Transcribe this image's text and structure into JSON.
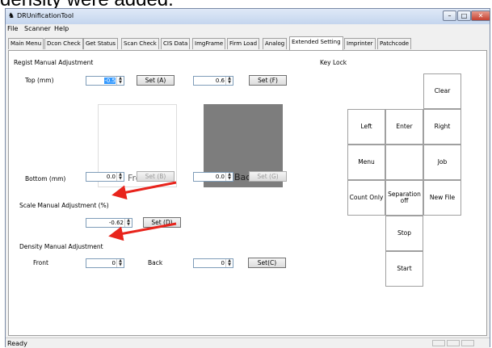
{
  "caption": "density were added.",
  "window": {
    "title": "DRUnificationTool",
    "controls": [
      "–",
      "□",
      "✕"
    ]
  },
  "menu": [
    "File",
    "Scanner",
    "Help"
  ],
  "tabs": [
    "Main Menu",
    "Dcon Check",
    "Get Status",
    "Scan Check",
    "CIS Data",
    "ImgFrame",
    "Firm Load",
    "Analog",
    "Extended Setting",
    "Imprinter",
    "Patchcode"
  ],
  "active_tab": "Extended Setting",
  "regist": {
    "title": "Regist Manual Adjustment",
    "top_label": "Top (mm)",
    "top_front": "-0.5",
    "top_back": "0.6",
    "set_a": "Set (A)",
    "set_f": "Set (F)",
    "front_label": "Front",
    "back_label": "Back",
    "bottom_label": "Bottom (mm)",
    "bottom_front": "0.0",
    "bottom_back": "0.0",
    "set_b": "Set (B)",
    "set_g": "Set (G)"
  },
  "scale": {
    "title": "Scale Manual Adjustment (%)",
    "value": "-0.62",
    "set_d": "Set (D)"
  },
  "density": {
    "title": "Density Manual Adjustment",
    "front_label": "Front",
    "front_value": "0",
    "back_label": "Back",
    "back_value": "0",
    "set_c": "Set(C)"
  },
  "keylock": {
    "title": "Key Lock",
    "clear": "Clear",
    "left": "Left",
    "enter": "Enter",
    "right": "Right",
    "menu": "Menu",
    "job": "Job",
    "count_only": "Count Only",
    "separation_off": "Separation off",
    "new_file": "New File",
    "stop": "Stop",
    "start": "Start"
  },
  "status": "Ready",
  "colors": {
    "annotation_arrow": "#e8241c",
    "back_preview": "#7d7d7d",
    "selection": "#3399ff"
  }
}
